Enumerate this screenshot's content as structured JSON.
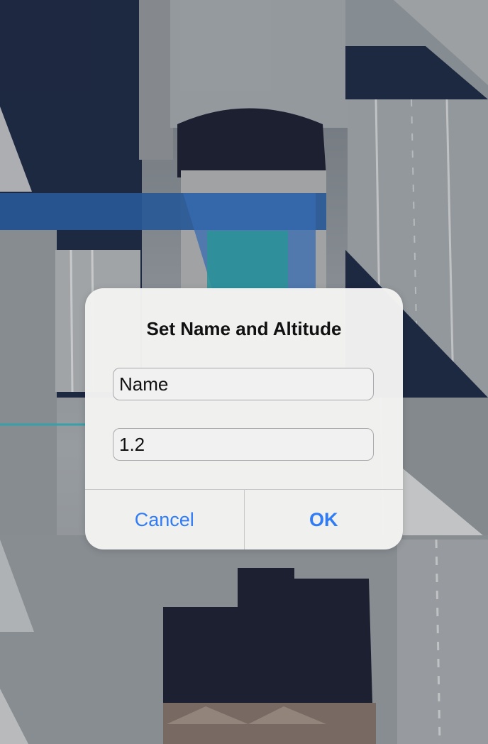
{
  "dialog": {
    "title": "Set Name and Altitude",
    "name_placeholder": "Name",
    "name_value": "",
    "altitude_value": "1.2",
    "cancel_label": "Cancel",
    "ok_label": "OK"
  },
  "colors": {
    "accent": "#2f7cf6",
    "dialog_background": "#f2f2f1"
  }
}
